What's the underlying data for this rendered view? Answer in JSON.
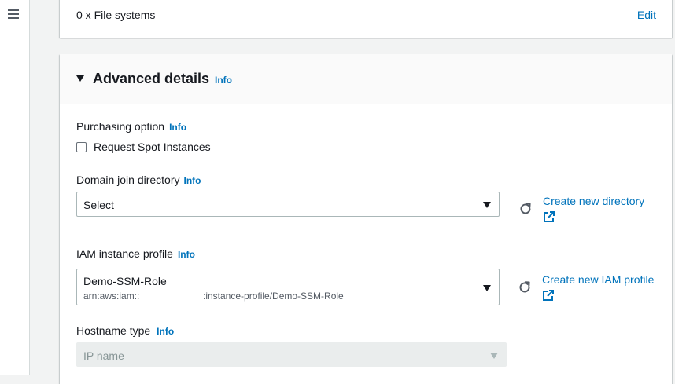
{
  "top_card": {
    "file_systems_text": "0 x File systems",
    "edit_label": "Edit"
  },
  "advanced": {
    "title": "Advanced details",
    "info_label": "Info",
    "purchasing_option": {
      "label": "Purchasing option",
      "info_label": "Info",
      "checkbox_label": "Request Spot Instances",
      "checked": false
    },
    "domain_join": {
      "label": "Domain join directory",
      "info_label": "Info",
      "selected": "Select",
      "create_link": "Create new directory"
    },
    "iam_profile": {
      "label": "IAM instance profile",
      "info_label": "Info",
      "selected": "Demo-SSM-Role",
      "selected_arn_prefix": "arn:aws:iam::",
      "selected_arn_suffix": ":instance-profile/Demo-SSM-Role",
      "create_link": "Create new IAM profile"
    },
    "hostname_type": {
      "label": "Hostname type",
      "info_label": "Info",
      "selected": "IP name",
      "disabled": true
    }
  },
  "colors": {
    "link": "#0073bb",
    "text": "#16191f",
    "background": "#f2f3f3"
  }
}
